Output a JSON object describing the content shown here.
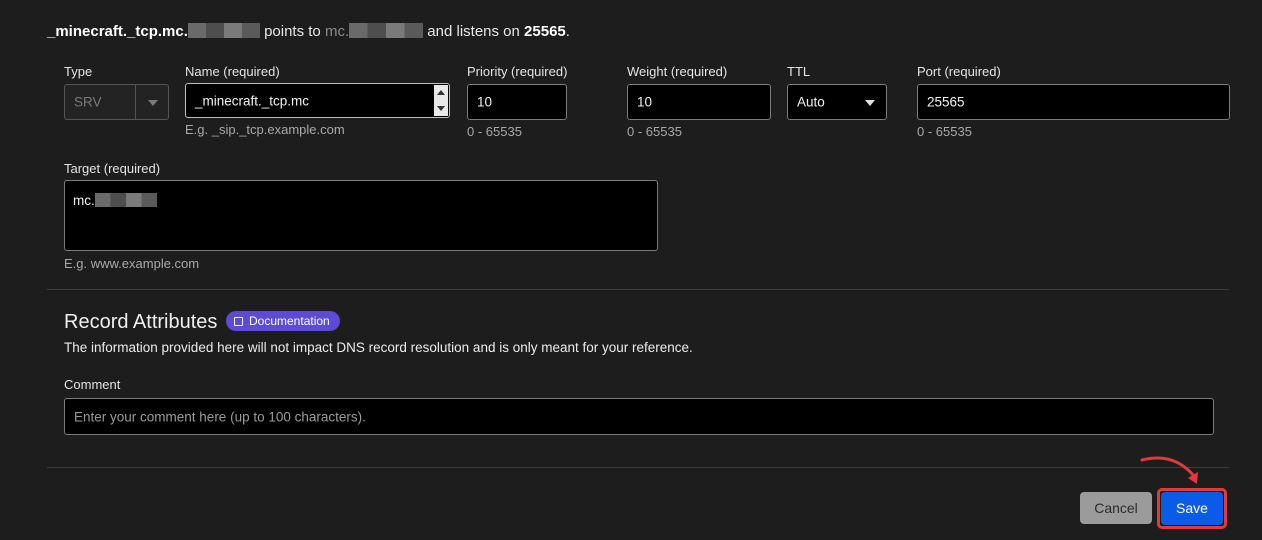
{
  "summary": {
    "name": "_minecraft._tcp.mc.",
    "points_to": "points to",
    "target": "mc.",
    "listens_on": "and listens on",
    "port": "25565",
    "end": "."
  },
  "fields": {
    "type": {
      "label": "Type",
      "value": "SRV"
    },
    "name": {
      "label": "Name (required)",
      "value": "_minecraft._tcp.mc",
      "hint": "E.g. _sip._tcp.example.com"
    },
    "priority": {
      "label": "Priority (required)",
      "value": "10",
      "hint": "0 - 65535"
    },
    "weight": {
      "label": "Weight (required)",
      "value": "10",
      "hint": "0 - 65535"
    },
    "ttl": {
      "label": "TTL",
      "value": "Auto"
    },
    "port": {
      "label": "Port (required)",
      "value": "25565",
      "hint": "0 - 65535"
    },
    "target": {
      "label": "Target (required)",
      "value": "mc.",
      "hint": "E.g. www.example.com"
    }
  },
  "attributes": {
    "title": "Record Attributes",
    "badge": "Documentation",
    "description": "The information provided here will not impact DNS record resolution and is only meant for your reference.",
    "comment_label": "Comment",
    "comment_placeholder": "Enter your comment here (up to 100 characters)."
  },
  "actions": {
    "cancel": "Cancel",
    "save": "Save"
  },
  "colors": {
    "accent": "#0a5ce8",
    "badge": "#5c4bd6",
    "annotation": "#e03a3a"
  },
  "icons": [
    "chevron-down-icon",
    "stepper-icon",
    "book-icon",
    "curved-arrow-icon"
  ]
}
